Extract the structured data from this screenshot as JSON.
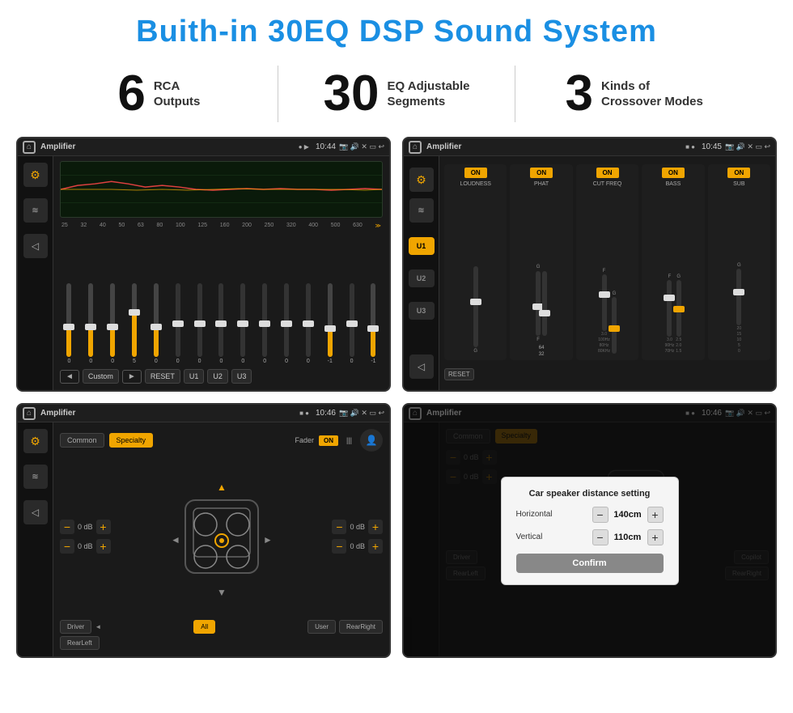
{
  "page": {
    "title": "Buith-in 30EQ DSP Sound System",
    "bg_color": "#ffffff"
  },
  "stats": [
    {
      "number": "6",
      "label_line1": "RCA",
      "label_line2": "Outputs"
    },
    {
      "number": "30",
      "label_line1": "EQ Adjustable",
      "label_line2": "Segments"
    },
    {
      "number": "3",
      "label_line1": "Kinds of",
      "label_line2": "Crossover Modes"
    }
  ],
  "screens": [
    {
      "id": "eq-screen",
      "title": "Amplifier",
      "time": "10:44",
      "type": "eq"
    },
    {
      "id": "crossover-screen",
      "title": "Amplifier",
      "time": "10:45",
      "type": "crossover"
    },
    {
      "id": "fader-screen",
      "title": "Amplifier",
      "time": "10:46",
      "type": "fader"
    },
    {
      "id": "dialog-screen",
      "title": "Amplifier",
      "time": "10:46",
      "type": "dialog"
    }
  ],
  "eq": {
    "freqs": [
      "25",
      "32",
      "40",
      "50",
      "63",
      "80",
      "100",
      "125",
      "160",
      "200",
      "250",
      "320",
      "400",
      "500",
      "630"
    ],
    "values": [
      "0",
      "0",
      "0",
      "5",
      "0",
      "0",
      "0",
      "0",
      "0",
      "0",
      "0",
      "0",
      "-1",
      "0",
      "-1"
    ],
    "preset": "Custom",
    "buttons": [
      "RESET",
      "U1",
      "U2",
      "U3"
    ]
  },
  "crossover": {
    "presets": [
      "U1",
      "U2",
      "U3"
    ],
    "channels": [
      "LOUDNESS",
      "PHAT",
      "CUT FREQ",
      "BASS",
      "SUB"
    ],
    "on_label": "ON",
    "reset_label": "RESET"
  },
  "fader": {
    "tabs": [
      "Common",
      "Specialty"
    ],
    "active_tab": "Specialty",
    "fader_label": "Fader",
    "on_label": "ON",
    "positions": [
      "Driver",
      "Copilot",
      "RearLeft",
      "RearRight"
    ],
    "all_label": "All",
    "user_label": "User",
    "db_values": [
      "0 dB",
      "0 dB",
      "0 dB",
      "0 dB"
    ]
  },
  "dialog": {
    "title": "Car speaker distance setting",
    "horizontal_label": "Horizontal",
    "horizontal_value": "140cm",
    "vertical_label": "Vertical",
    "vertical_value": "110cm",
    "confirm_label": "Confirm",
    "tabs": [
      "Common",
      "Specialty"
    ],
    "db_values": [
      "0 dB",
      "0 dB"
    ],
    "positions": [
      "Driver",
      "Copilot",
      "RearLeft",
      "RearRight"
    ]
  }
}
